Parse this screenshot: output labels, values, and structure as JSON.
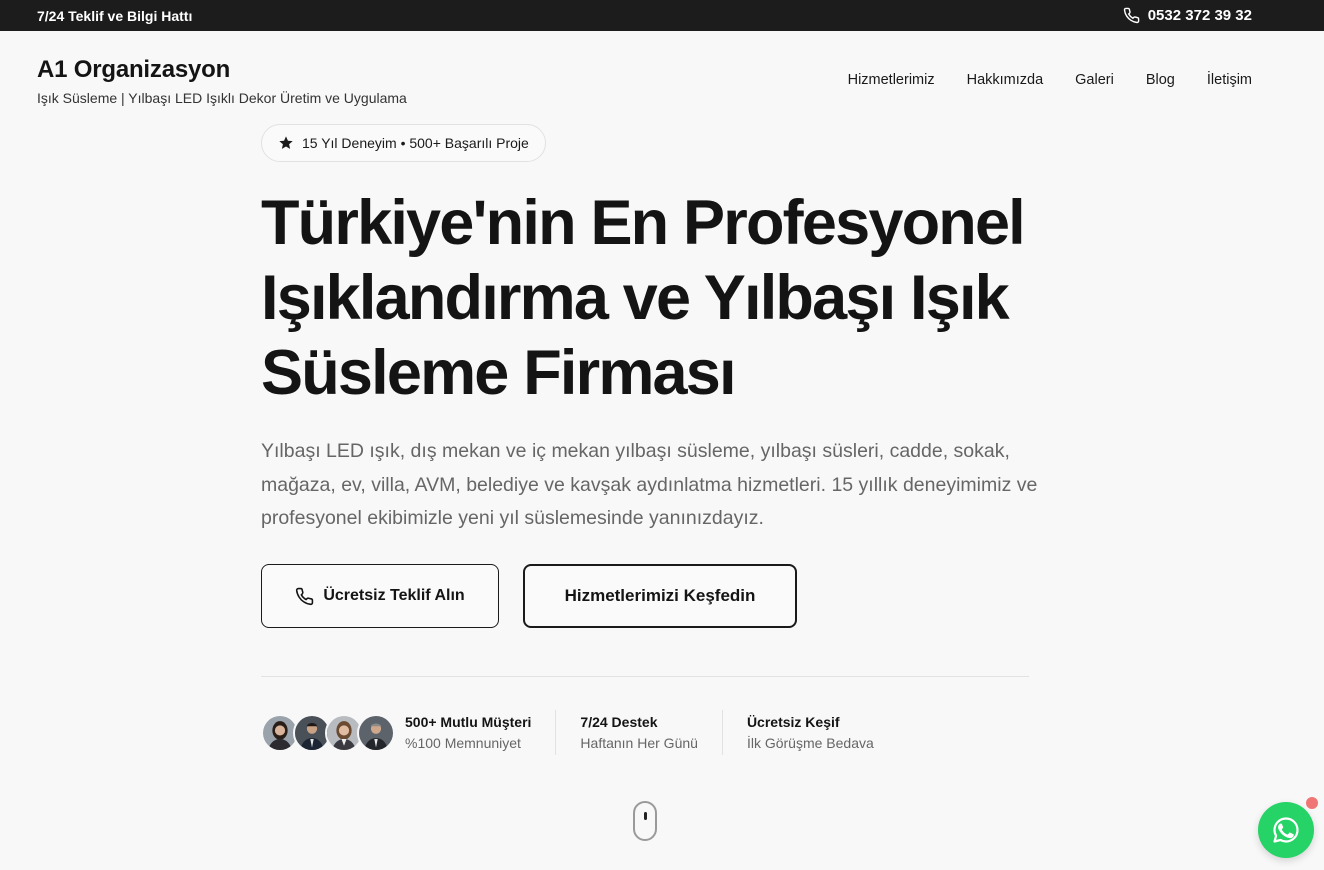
{
  "topbar": {
    "hotline_label": "7/24 Teklif ve Bilgi Hattı",
    "phone": "0532 372 39 32"
  },
  "brand": {
    "name": "A1 Organizasyon",
    "tagline": "Işık Süsleme | Yılbaşı LED Işıklı Dekor Üretim ve Uygulama"
  },
  "nav": {
    "items": [
      "Hizmetlerimiz",
      "Hakkımızda",
      "Galeri",
      "Blog",
      "İletişim"
    ]
  },
  "hero": {
    "badge": "15 Yıl Deneyim • 500+ Başarılı Proje",
    "headline": "Türkiye'nin En Profesyonel Işıklandırma ve Yılbaşı Işık Süsleme Firması",
    "lead": "Yılbaşı LED ışık, dış mekan ve iç mekan yılbaşı süsleme, yılbaşı süsleri, cadde, sokak, mağaza, ev, villa, AVM, belediye ve kavşak aydınlatma hizmetleri. 15 yıllık deneyimimiz ve profesyonel ekibimizle yeni yıl süslemesinde yanınızdayız.",
    "cta_primary": "Ücretsiz Teklif Alın",
    "cta_secondary": "Hizmetlerimizi Keşfedin"
  },
  "stats": [
    {
      "title": "500+ Mutlu Müşteri",
      "subtitle": "%100 Memnuniyet"
    },
    {
      "title": "7/24 Destek",
      "subtitle": "Haftanın Her Günü"
    },
    {
      "title": "Ücretsiz Keşif",
      "subtitle": "İlk Görüşme Bedava"
    }
  ],
  "icons": {
    "phone": "phone-icon",
    "star": "star-icon",
    "scroll": "scroll-mouse-icon",
    "whatsapp": "whatsapp-icon"
  },
  "colors": {
    "topbar_bg": "#1c1c1c",
    "whatsapp_green": "#25d366",
    "notification_dot": "#f07575"
  }
}
